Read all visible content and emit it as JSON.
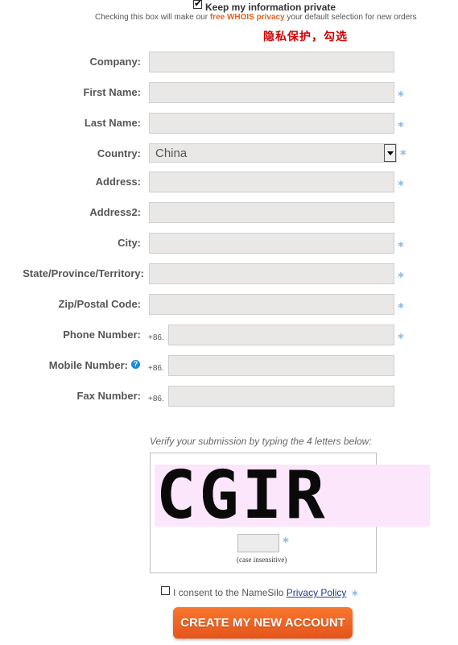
{
  "privacy": {
    "title": "Keep my information private",
    "note_before": "Checking this box will make our ",
    "note_highlight": "free WHOIS privacy",
    "note_after": " your default selection for new orders",
    "annotation": "隐私保护，勾选",
    "checked": true
  },
  "form": {
    "required_marker": "*",
    "phone_prefix": "+86.",
    "fields": {
      "company": "Company:",
      "first_name": "First Name:",
      "last_name": "Last Name:",
      "country": "Country:",
      "address": "Address:",
      "address2": "Address2:",
      "city": "City:",
      "state": "State/Province/Territory:",
      "zip": "Zip/Postal Code:",
      "phone": "Phone Number:",
      "mobile": "Mobile Number:",
      "fax": "Fax Number:"
    },
    "country_value": "China",
    "help_icon": "?"
  },
  "verification": {
    "instruction": "Verify your submission by typing the 4 letters below:",
    "captcha_text": "CGIR",
    "case_note": "(case insensitive)"
  },
  "consent": {
    "text": "I consent to the NameSilo ",
    "link": "Privacy Policy"
  },
  "submit": {
    "label": "CREATE MY NEW ACCOUNT"
  },
  "colors": {
    "accent": "#e8601c",
    "required": "#8ab8e0",
    "annotation": "#d40000"
  }
}
